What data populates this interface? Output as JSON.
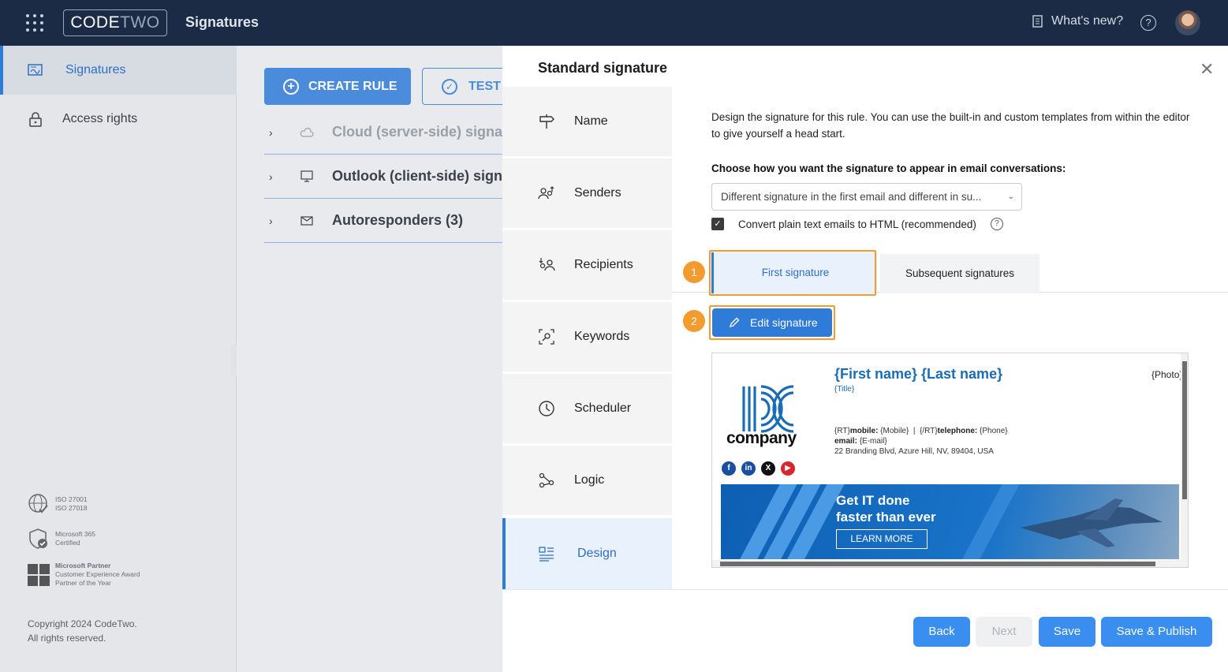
{
  "topbar": {
    "brand_part1": "CODE",
    "brand_part2": "TWO",
    "app_title": "Signatures",
    "whats_new": "What's new?",
    "help": "?"
  },
  "sidebar": {
    "items": [
      {
        "label": "Signatures",
        "icon": "signatures-icon",
        "active": true
      },
      {
        "label": "Access rights",
        "icon": "lock-icon",
        "active": false
      }
    ],
    "badges": [
      {
        "lines": [
          "ISO 27001",
          "ISO 27018"
        ]
      },
      {
        "lines": [
          "Microsoft 365",
          "Certified"
        ]
      },
      {
        "lines": [
          "Microsoft Partner",
          "Customer Experience Award",
          "Partner of the Year"
        ]
      }
    ],
    "copyright_line1": "Copyright 2024 CodeTwo.",
    "copyright_line2": "All rights reserved."
  },
  "main": {
    "create_rule": "CREATE RULE",
    "test": "TEST",
    "groups": [
      {
        "label": "Cloud (server-side) signatures",
        "muted": true
      },
      {
        "label": "Outlook (client-side) signatures",
        "muted": false
      },
      {
        "label": "Autoresponders (3)",
        "muted": false
      }
    ]
  },
  "panel": {
    "title": "Standard signature",
    "steps": [
      {
        "label": "Name",
        "icon": "signpost-icon"
      },
      {
        "label": "Senders",
        "icon": "senders-icon"
      },
      {
        "label": "Recipients",
        "icon": "recipients-icon"
      },
      {
        "label": "Keywords",
        "icon": "keywords-icon"
      },
      {
        "label": "Scheduler",
        "icon": "clock-icon"
      },
      {
        "label": "Logic",
        "icon": "logic-icon"
      },
      {
        "label": "Design",
        "icon": "design-icon",
        "active": true
      }
    ],
    "intro": "Design the signature for this rule. You can use the built-in and custom templates from within the editor to give yourself a head start.",
    "choose_label": "Choose how you want the signature to appear in email conversations:",
    "select_value": "Different signature in the first email and different in su...",
    "convert_label": "Convert plain text emails to HTML (recommended)",
    "convert_checked": true,
    "tab_first": "First signature",
    "tab_subsequent": "Subsequent signatures",
    "step_badge_1": "1",
    "step_badge_2": "2",
    "edit_signature": "Edit signature",
    "footer": {
      "back": "Back",
      "next": "Next",
      "save": "Save",
      "save_publish": "Save & Publish"
    }
  },
  "signature_preview": {
    "company": "company",
    "name": "{First name} {Last name}",
    "title": "{Title}",
    "photo": "{Photo}",
    "contact_line1_prefix": "{RT}",
    "mobile_label": "mobile:",
    "mobile_value": "{Mobile}",
    "sep": "|",
    "contact_line1_mid": "{/RT}",
    "telephone_label": "telephone:",
    "telephone_value": "{Phone}",
    "email_label": "email:",
    "email_value": "{E-mail}",
    "address": "22 Branding Blvd, Azure Hill, NV, 89404, USA",
    "banner_line1": "Get IT done",
    "banner_line2": "faster than ever",
    "banner_cta": "LEARN MORE",
    "social": [
      "f",
      "in",
      "X",
      "▶"
    ],
    "colors": {
      "brand": "#1a6db5",
      "accent": "#2f7bd8",
      "highlight": "#f39b2e"
    }
  }
}
